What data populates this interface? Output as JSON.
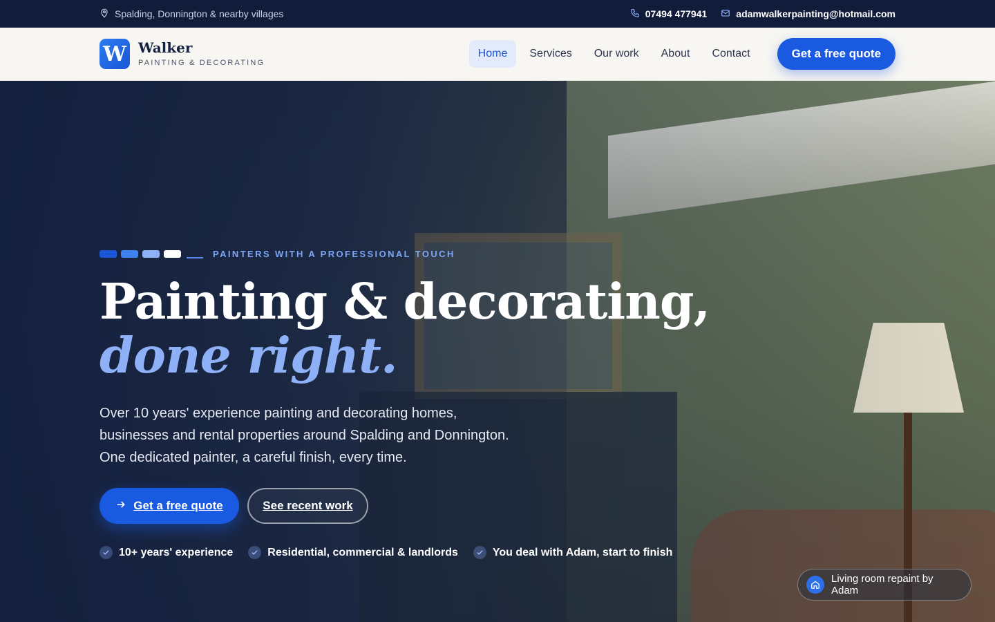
{
  "topbar": {
    "location": "Spalding, Donnington & nearby villages",
    "phone": "07494 477941",
    "email": "adamwalkerpainting@hotmail.com"
  },
  "header": {
    "logo_letter": "W",
    "brand_name": "Walker",
    "brand_tagline": "PAINTING & DECORATING",
    "nav": [
      {
        "label": "Home",
        "active": true
      },
      {
        "label": "Services",
        "active": false
      },
      {
        "label": "Our work",
        "active": false
      },
      {
        "label": "About",
        "active": false
      },
      {
        "label": "Contact",
        "active": false
      }
    ],
    "cta_label": "Get a free quote"
  },
  "hero": {
    "eyebrow_bar_colors": [
      "#1a56d6",
      "#3d82f0",
      "#8fb1f6",
      "#ffffff"
    ],
    "eyebrow": "PAINTERS WITH A PROFESSIONAL TOUCH",
    "headline_line1": "Painting & decorating,",
    "headline_line2": "done right.",
    "subtext": "Over 10 years' experience painting and decorating homes, businesses and rental properties around Spalding and Donnington. One dedicated painter, a careful finish, every time.",
    "primary_button": "Get a free quote",
    "secondary_button": "See recent work",
    "checks": [
      "10+ years' experience",
      "Residential, commercial & landlords",
      "You deal with Adam, start to finish"
    ],
    "photo_caption": "Living room repaint by Adam"
  },
  "colors": {
    "brand_blue": "#1a5ae0",
    "accent_light_blue": "#8db0f7",
    "topbar_bg": "#111c3b",
    "header_bg": "#f7f6f2"
  },
  "icons": {
    "location": "map-pin-icon",
    "phone": "phone-icon",
    "email": "mail-icon",
    "arrow": "arrow-right-icon",
    "check": "check-icon",
    "home": "home-icon"
  }
}
